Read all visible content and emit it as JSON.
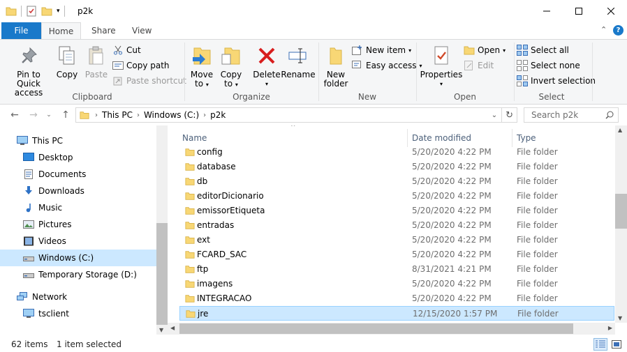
{
  "window": {
    "title": "p2k",
    "minimize_icon": "minimize-icon",
    "maximize_icon": "maximize-icon",
    "close_icon": "close-icon"
  },
  "ribbon_tabs": {
    "file": "File",
    "home": "Home",
    "share": "Share",
    "view": "View"
  },
  "ribbon": {
    "clipboard": {
      "label": "Clipboard",
      "pin_line1": "Pin to Quick",
      "pin_line2": "access",
      "copy": "Copy",
      "paste": "Paste",
      "cut": "Cut",
      "copy_path": "Copy path",
      "paste_shortcut": "Paste shortcut"
    },
    "organize": {
      "label": "Organize",
      "move_line1": "Move",
      "move_line2": "to",
      "copy_line1": "Copy",
      "copy_line2": "to",
      "delete": "Delete",
      "rename": "Rename"
    },
    "new": {
      "label": "New",
      "folder_line1": "New",
      "folder_line2": "folder",
      "new_item": "New item",
      "easy_access": "Easy access"
    },
    "open": {
      "label": "Open",
      "properties": "Properties",
      "open": "Open",
      "edit": "Edit"
    },
    "select": {
      "label": "Select",
      "select_all": "Select all",
      "select_none": "Select none",
      "invert": "Invert selection"
    }
  },
  "address": {
    "crumbs": [
      "This PC",
      "Windows (C:)",
      "p2k"
    ],
    "search_placeholder": "Search p2k"
  },
  "nav_pane": [
    {
      "label": "This PC",
      "icon": "computer-icon",
      "indent": 0
    },
    {
      "label": "Desktop",
      "icon": "desktop-icon",
      "indent": 1
    },
    {
      "label": "Documents",
      "icon": "documents-icon",
      "indent": 1
    },
    {
      "label": "Downloads",
      "icon": "downloads-icon",
      "indent": 1
    },
    {
      "label": "Music",
      "icon": "music-icon",
      "indent": 1
    },
    {
      "label": "Pictures",
      "icon": "pictures-icon",
      "indent": 1
    },
    {
      "label": "Videos",
      "icon": "videos-icon",
      "indent": 1
    },
    {
      "label": "Windows (C:)",
      "icon": "drive-icon",
      "indent": 1,
      "selected": true
    },
    {
      "label": "Temporary Storage (D:)",
      "icon": "drive-icon",
      "indent": 1
    },
    {
      "label": "Network",
      "icon": "network-icon",
      "indent": 0
    },
    {
      "label": "tsclient",
      "icon": "computer-icon",
      "indent": 1
    }
  ],
  "columns": {
    "name": "Name",
    "date": "Date modified",
    "type": "Type"
  },
  "files": [
    {
      "name": "config",
      "date": "5/20/2020 4:22 PM",
      "type": "File folder"
    },
    {
      "name": "database",
      "date": "5/20/2020 4:22 PM",
      "type": "File folder"
    },
    {
      "name": "db",
      "date": "5/20/2020 4:22 PM",
      "type": "File folder"
    },
    {
      "name": "editorDicionario",
      "date": "5/20/2020 4:22 PM",
      "type": "File folder"
    },
    {
      "name": "emissorEtiqueta",
      "date": "5/20/2020 4:22 PM",
      "type": "File folder"
    },
    {
      "name": "entradas",
      "date": "5/20/2020 4:22 PM",
      "type": "File folder"
    },
    {
      "name": "ext",
      "date": "5/20/2020 4:22 PM",
      "type": "File folder"
    },
    {
      "name": "FCARD_SAC",
      "date": "5/20/2020 4:22 PM",
      "type": "File folder"
    },
    {
      "name": "ftp",
      "date": "8/31/2021 4:21 PM",
      "type": "File folder"
    },
    {
      "name": "imagens",
      "date": "5/20/2020 4:22 PM",
      "type": "File folder"
    },
    {
      "name": "INTEGRACAO",
      "date": "5/20/2020 4:22 PM",
      "type": "File folder"
    },
    {
      "name": "jre",
      "date": "12/15/2020 1:57 PM",
      "type": "File folder",
      "selected": true
    }
  ],
  "status": {
    "items": "62 items",
    "selected": "1 item selected"
  },
  "colors": {
    "accent": "#1979ca",
    "selection": "#cce8ff",
    "folder": "#f8d775"
  }
}
